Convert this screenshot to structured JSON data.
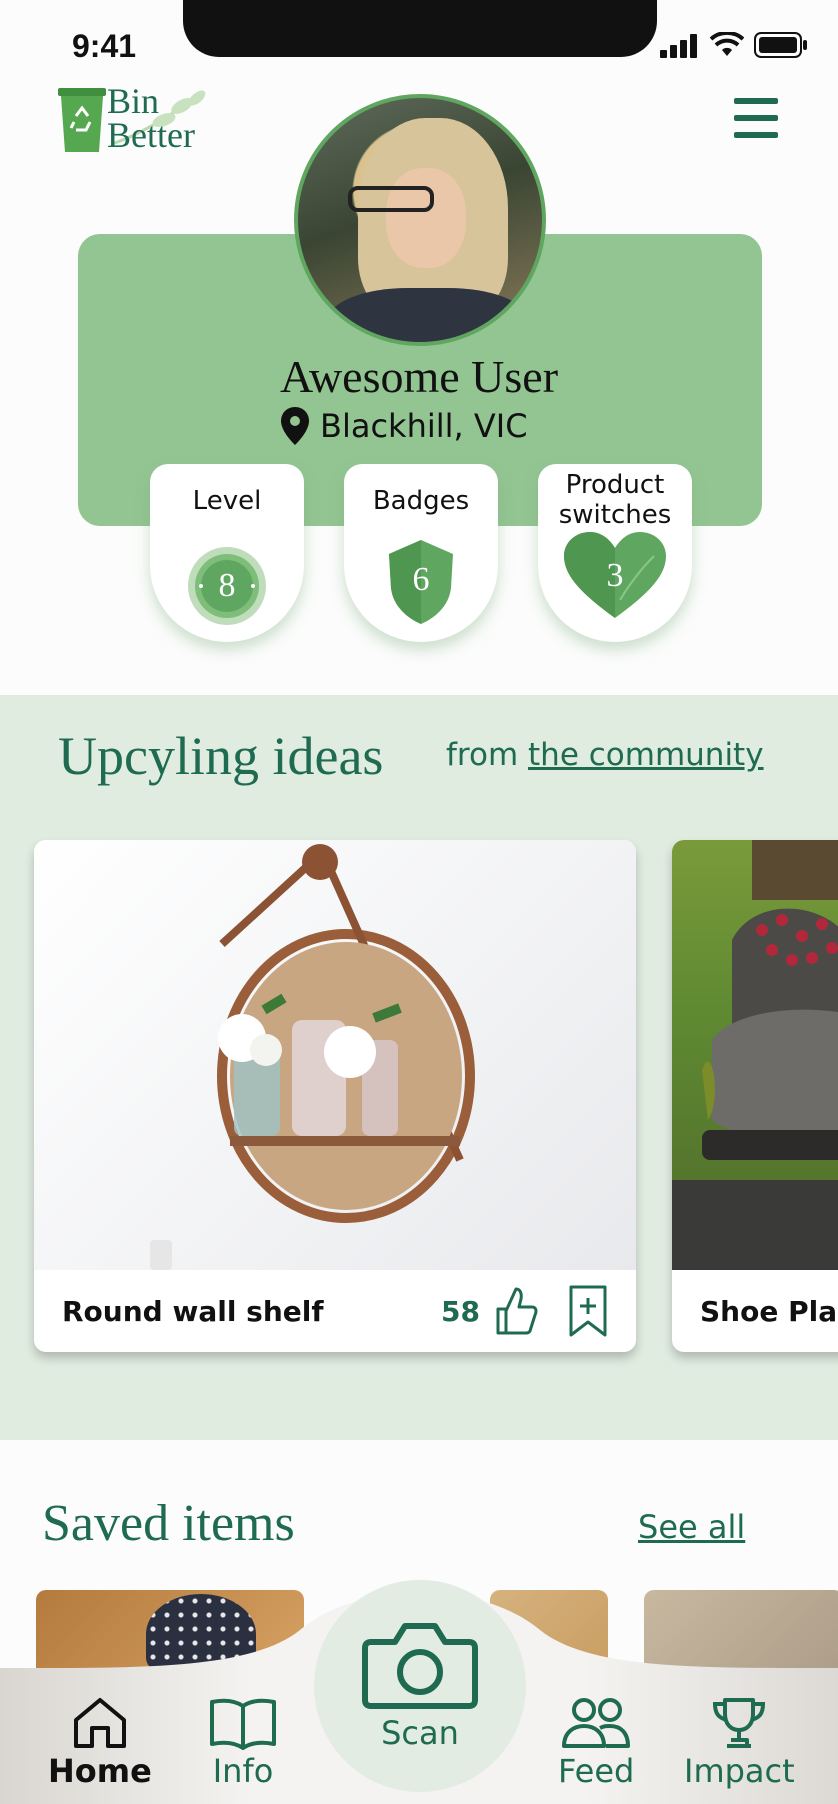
{
  "status_bar": {
    "time": "9:41"
  },
  "app": {
    "logo_line1": "Bin",
    "logo_line2": "Better"
  },
  "profile": {
    "name": "Awesome User",
    "location": "Blackhill, VIC",
    "stats": [
      {
        "label": "Level",
        "value": "8"
      },
      {
        "label": "Badges",
        "value": "6"
      },
      {
        "label_line1": "Product",
        "label_line2": "switches",
        "value": "3"
      }
    ]
  },
  "upcycling": {
    "title": "Upcyling ideas",
    "from_prefix": "from",
    "from_link": "the community",
    "cards": [
      {
        "title": "Round wall shelf",
        "likes": "58"
      },
      {
        "title": "Shoe Plan"
      }
    ]
  },
  "saved": {
    "title": "Saved items",
    "see_all": "See all"
  },
  "nav": {
    "home": "Home",
    "info": "Info",
    "scan": "Scan",
    "feed": "Feed",
    "impact": "Impact"
  },
  "colors": {
    "brand_green": "#1f6b52",
    "card_green": "#93c592",
    "section_bg": "#e1ece1",
    "badge_green": "#5fa761"
  }
}
